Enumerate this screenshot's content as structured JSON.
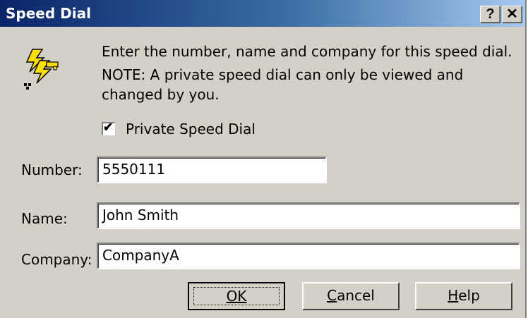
{
  "window": {
    "title": "Speed Dial",
    "help_glyph": "?",
    "close_glyph": "✕"
  },
  "icon": "lightning-phone-key-icon",
  "instructions": {
    "intro": "Enter the number, name and company for this speed dial.",
    "note": "NOTE: A private speed dial can only be viewed and changed by you."
  },
  "private_checkbox": {
    "label": "Private Speed Dial",
    "checked": true,
    "check_glyph": "✔"
  },
  "fields": {
    "number": {
      "label": "Number:",
      "value": "5550111"
    },
    "name": {
      "label": "Name:",
      "value": "John Smith"
    },
    "company": {
      "label": "Company:",
      "value": "CompanyA"
    }
  },
  "buttons": {
    "ok": "OK",
    "cancel": "Cancel",
    "help": "Help"
  },
  "colors": {
    "title_gradient_start": "#0a246a",
    "title_gradient_end": "#a6caf0",
    "dialog_face": "#d4d0c8",
    "icon_yellow": "#ffe000"
  }
}
